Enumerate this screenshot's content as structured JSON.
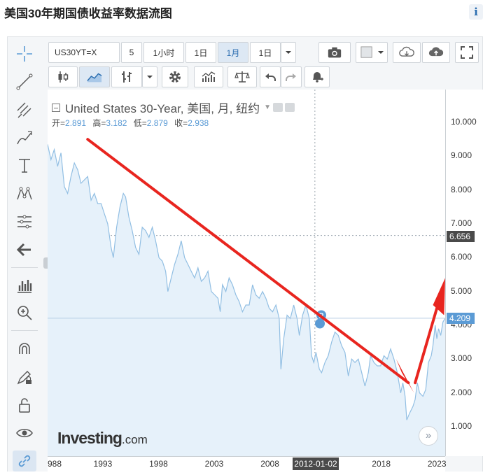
{
  "page": {
    "title": "美国30年期国债收益率数据流图",
    "info_icon": "i"
  },
  "toolbar": {
    "symbol": "US30YT=X",
    "multiplier": "5",
    "intervals": [
      "1小时",
      "1日",
      "1月",
      "1日"
    ],
    "active_interval": "1月",
    "icons": [
      "camera-icon",
      "color-swatch-icon",
      "dropdown-arrow-icon",
      "cloud-download-icon",
      "cloud-upload-icon",
      "fullscreen-icon",
      "candlestick-icon",
      "area-chart-icon",
      "bar-style-icon",
      "settings-gear-icon",
      "indicators-icon",
      "compare-scale-icon",
      "undo-icon",
      "redo-icon",
      "alert-bell-icon"
    ]
  },
  "left_tools": [
    "crosshair-icon",
    "trend-line-icon",
    "pitchfork-icon",
    "brush-icon",
    "text-tool-icon",
    "pattern-icon",
    "fib-tool-icon",
    "back-arrow-icon",
    "depth-icon",
    "zoom-in-icon",
    "magnet-icon",
    "lock-drawing-icon",
    "unlock-icon",
    "eye-icon",
    "link-icon"
  ],
  "legend": {
    "title": "United States 30-Year, 美国, 月, 纽约",
    "open_label": "开=",
    "open": "2.891",
    "high_label": "高=",
    "high": "3.182",
    "low_label": "低=",
    "low": "2.879",
    "close_label": "收=",
    "close": "2.938"
  },
  "watermark": {
    "brand": "Investing",
    "suffix": ".com"
  },
  "scroll_button": "»",
  "markers": {
    "p": "P"
  },
  "crosshair": {
    "time_label": "2012-01-02",
    "price_label": "6.656"
  },
  "current_price": "4.209",
  "colors": {
    "series_line": "#92bfe3",
    "series_fill": "#e6f1fa",
    "arrow": "#e8251f",
    "price_badge": "#5b9bd5",
    "crosshair_badge": "#4a4a4a"
  },
  "chart_data": {
    "type": "area",
    "title": "United States 30-Year",
    "x_ticks": [
      "988",
      "1993",
      "1998",
      "2003",
      "2008",
      "2018",
      "2023"
    ],
    "y_ticks": [
      "10.000",
      "9.000",
      "8.000",
      "7.000",
      "6.000",
      "5.000",
      "4.000",
      "3.000",
      "2.000",
      "1.000"
    ],
    "ylim": [
      0.0,
      10.4
    ],
    "xlim": [
      1988.0,
      2023.7
    ],
    "series": [
      {
        "values": [
          [
            1988.0,
            9.35
          ],
          [
            1988.3,
            8.9
          ],
          [
            1988.6,
            9.2
          ],
          [
            1988.9,
            8.7
          ],
          [
            1989.2,
            9.1
          ],
          [
            1989.5,
            8.1
          ],
          [
            1989.8,
            7.9
          ],
          [
            1990.1,
            8.4
          ],
          [
            1990.4,
            8.8
          ],
          [
            1990.7,
            8.6
          ],
          [
            1991.0,
            8.2
          ],
          [
            1991.3,
            8.3
          ],
          [
            1991.6,
            8.4
          ],
          [
            1991.9,
            7.7
          ],
          [
            1992.2,
            7.9
          ],
          [
            1992.5,
            7.6
          ],
          [
            1992.8,
            7.6
          ],
          [
            1993.1,
            7.3
          ],
          [
            1993.4,
            7.0
          ],
          [
            1993.7,
            6.3
          ],
          [
            1993.9,
            6.0
          ],
          [
            1994.2,
            6.9
          ],
          [
            1994.5,
            7.5
          ],
          [
            1994.8,
            7.9
          ],
          [
            1995.0,
            7.8
          ],
          [
            1995.3,
            7.2
          ],
          [
            1995.6,
            6.8
          ],
          [
            1995.9,
            6.3
          ],
          [
            1996.2,
            6.1
          ],
          [
            1996.5,
            6.9
          ],
          [
            1996.8,
            6.8
          ],
          [
            1997.1,
            6.6
          ],
          [
            1997.4,
            6.9
          ],
          [
            1997.7,
            6.5
          ],
          [
            1998.0,
            6.0
          ],
          [
            1998.3,
            5.9
          ],
          [
            1998.6,
            5.6
          ],
          [
            1998.8,
            5.0
          ],
          [
            1999.1,
            5.4
          ],
          [
            1999.4,
            5.8
          ],
          [
            1999.7,
            6.1
          ],
          [
            2000.0,
            6.5
          ],
          [
            2000.3,
            6.0
          ],
          [
            2000.6,
            5.8
          ],
          [
            2000.9,
            5.6
          ],
          [
            2001.2,
            5.4
          ],
          [
            2001.5,
            5.7
          ],
          [
            2001.8,
            5.3
          ],
          [
            2002.1,
            5.4
          ],
          [
            2002.4,
            5.6
          ],
          [
            2002.7,
            5.0
          ],
          [
            2003.0,
            4.9
          ],
          [
            2003.3,
            4.8
          ],
          [
            2003.5,
            4.4
          ],
          [
            2003.7,
            5.2
          ],
          [
            2004.0,
            5.0
          ],
          [
            2004.3,
            5.4
          ],
          [
            2004.6,
            5.2
          ],
          [
            2004.9,
            4.9
          ],
          [
            2005.2,
            4.7
          ],
          [
            2005.5,
            4.4
          ],
          [
            2005.8,
            4.6
          ],
          [
            2006.1,
            4.6
          ],
          [
            2006.4,
            5.2
          ],
          [
            2006.7,
            4.9
          ],
          [
            2007.0,
            4.8
          ],
          [
            2007.3,
            5.0
          ],
          [
            2007.6,
            4.8
          ],
          [
            2007.9,
            4.5
          ],
          [
            2008.2,
            4.4
          ],
          [
            2008.5,
            4.6
          ],
          [
            2008.8,
            4.2
          ],
          [
            2008.95,
            2.7
          ],
          [
            2009.2,
            3.6
          ],
          [
            2009.5,
            4.3
          ],
          [
            2009.8,
            4.2
          ],
          [
            2010.1,
            4.6
          ],
          [
            2010.4,
            4.2
          ],
          [
            2010.6,
            3.7
          ],
          [
            2010.9,
            4.3
          ],
          [
            2011.2,
            4.6
          ],
          [
            2011.5,
            4.2
          ],
          [
            2011.7,
            3.1
          ],
          [
            2011.9,
            2.9
          ],
          [
            2012.1,
            3.2
          ],
          [
            2012.4,
            2.7
          ],
          [
            2012.6,
            2.6
          ],
          [
            2012.9,
            2.9
          ],
          [
            2013.2,
            3.1
          ],
          [
            2013.5,
            3.5
          ],
          [
            2013.8,
            3.8
          ],
          [
            2014.1,
            3.7
          ],
          [
            2014.4,
            3.4
          ],
          [
            2014.7,
            3.2
          ],
          [
            2015.0,
            2.5
          ],
          [
            2015.3,
            3.0
          ],
          [
            2015.6,
            2.9
          ],
          [
            2015.9,
            3.0
          ],
          [
            2016.2,
            2.6
          ],
          [
            2016.5,
            2.2
          ],
          [
            2016.8,
            2.6
          ],
          [
            2017.0,
            3.1
          ],
          [
            2017.3,
            2.9
          ],
          [
            2017.6,
            2.8
          ],
          [
            2017.9,
            2.8
          ],
          [
            2018.2,
            3.1
          ],
          [
            2018.5,
            3.0
          ],
          [
            2018.8,
            3.3
          ],
          [
            2019.1,
            3.0
          ],
          [
            2019.4,
            2.6
          ],
          [
            2019.7,
            2.0
          ],
          [
            2019.9,
            2.3
          ],
          [
            2020.1,
            1.9
          ],
          [
            2020.25,
            1.2
          ],
          [
            2020.5,
            1.4
          ],
          [
            2020.8,
            1.6
          ],
          [
            2021.0,
            1.8
          ],
          [
            2021.2,
            2.3
          ],
          [
            2021.4,
            2.0
          ],
          [
            2021.7,
            1.9
          ],
          [
            2021.95,
            2.1
          ],
          [
            2022.2,
            2.9
          ],
          [
            2022.45,
            3.1
          ],
          [
            2022.6,
            3.4
          ],
          [
            2022.8,
            4.0
          ],
          [
            2022.95,
            3.6
          ],
          [
            2023.1,
            3.9
          ],
          [
            2023.3,
            3.7
          ],
          [
            2023.5,
            4.1
          ],
          [
            2023.7,
            4.21
          ]
        ]
      }
    ],
    "crosshair": {
      "x": 2012.0,
      "y": 6.656
    },
    "last_value": 4.209
  }
}
